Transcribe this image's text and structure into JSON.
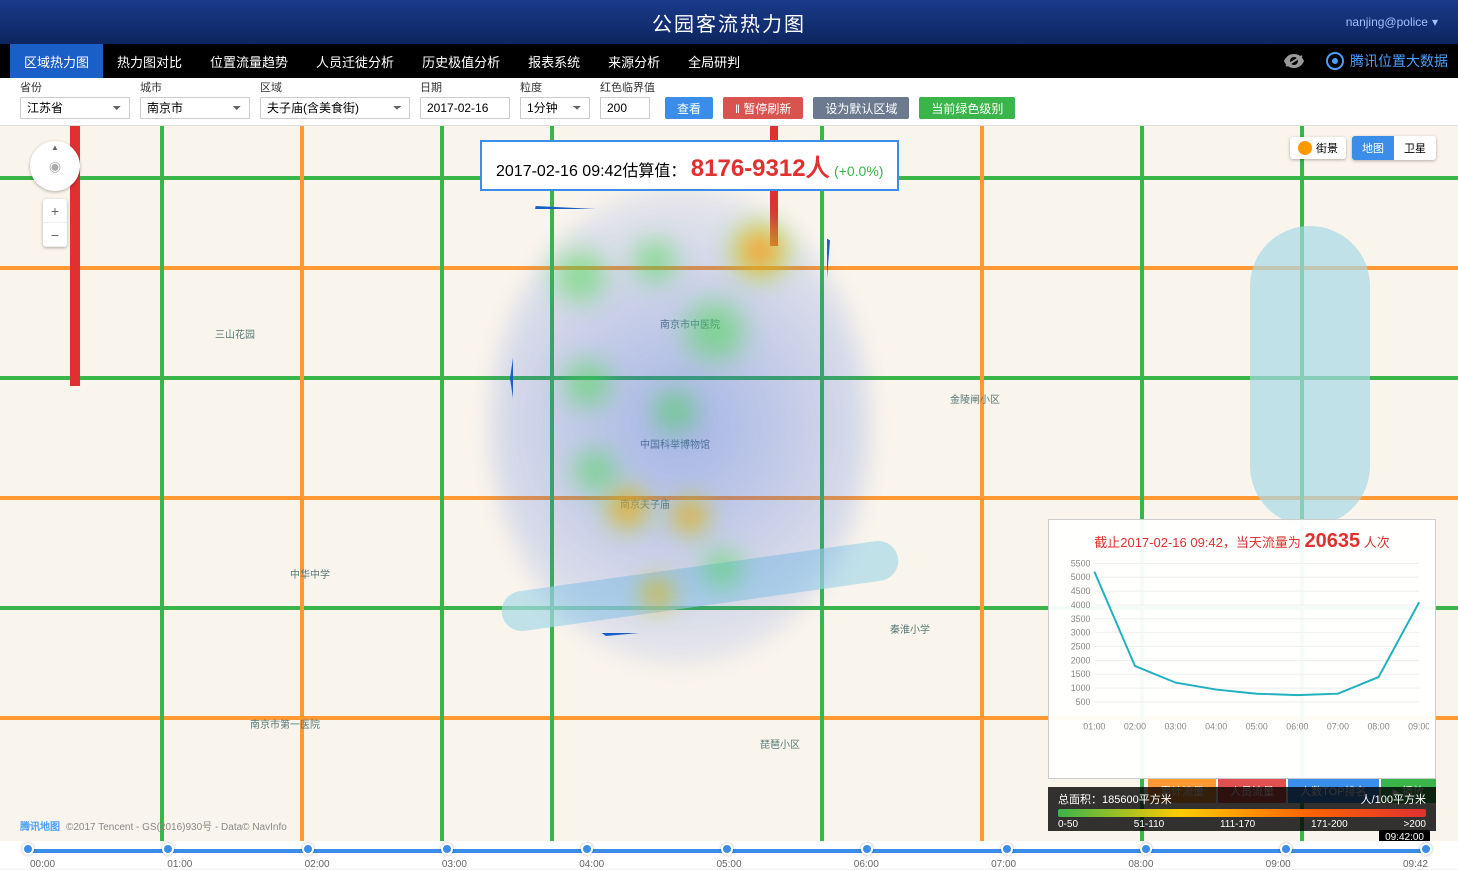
{
  "header": {
    "title": "公园客流热力图",
    "user": "nanjing@police"
  },
  "nav": {
    "items": [
      "区域热力图",
      "热力图对比",
      "位置流量趋势",
      "人员迁徙分析",
      "历史极值分析",
      "报表系统",
      "来源分析",
      "全局研判"
    ],
    "activeIndex": 0,
    "brand": "腾讯位置大数据"
  },
  "filters": {
    "province": {
      "label": "省份",
      "value": "江苏省"
    },
    "city": {
      "label": "城市",
      "value": "南京市"
    },
    "region": {
      "label": "区域",
      "value": "夫子庙(含美食街)"
    },
    "date": {
      "label": "日期",
      "value": "2017-02-16"
    },
    "granularity": {
      "label": "粒度",
      "value": "1分钟"
    },
    "threshold": {
      "label": "红色临界值",
      "value": "200"
    },
    "buttons": {
      "search": "查看",
      "pause": "暂停刷新",
      "setDefault": "设为默认区域",
      "levelCheck": "当前绿色级别"
    }
  },
  "estimate": {
    "prefix": "2017-02-16 09:42估算值：",
    "range": "8176-9312人",
    "pct": "(+0.0%)"
  },
  "mapControls": {
    "streetview": "街景",
    "mapType": {
      "map": "地图",
      "satellite": "卫星"
    },
    "attribution": "©2017 Tencent - GS(2016)930号 - Data© NavInfo",
    "attribLogo": "腾讯地图"
  },
  "chart_data": {
    "type": "line",
    "title_prefix": "截止2017-02-16 09:42，当天流量为 ",
    "title_value": "20635",
    "title_suffix": " 人次",
    "xlabel": "",
    "ylabel": "",
    "x": [
      "01:00",
      "02:00",
      "03:00",
      "04:00",
      "05:00",
      "06:00",
      "07:00",
      "08:00",
      "09:00"
    ],
    "values": [
      5200,
      1800,
      1200,
      950,
      800,
      750,
      800,
      1400,
      4100
    ],
    "ylim": [
      0,
      5500
    ],
    "yticks": [
      500,
      1000,
      1500,
      2000,
      2500,
      3000,
      3500,
      4000,
      4500,
      5000,
      5500
    ]
  },
  "chartTabs": {
    "cumulative": "累计流量",
    "peopleFlow": "人员流量",
    "topRank": "人数TOP排名",
    "play": "播放"
  },
  "legend": {
    "area": "总面积：185600平方米",
    "unit": "人/100平方米",
    "ranges": [
      "0-50",
      "51-110",
      "111-170",
      "171-200",
      ">200"
    ]
  },
  "timeline": {
    "labels": [
      "00:00",
      "01:00",
      "02:00",
      "03:00",
      "04:00",
      "05:00",
      "06:00",
      "07:00",
      "08:00",
      "09:00",
      "09:42"
    ],
    "currentBadge": "09:42:00"
  },
  "poi": {
    "sanshanhuayuan": "三山花园",
    "zhonghuazhongxue": "中华中学",
    "nanjingdiyiyiyuan": "南京市第一医院",
    "fuzimiao": "南京夫子庙",
    "zhongyiyuan": "南京市中医院",
    "kexuebowuguan": "中国科举博物馆",
    "jinlingzha": "金陵闸小区",
    "pipa": "琵琶小区",
    "qinhuai": "秦淮小学"
  }
}
